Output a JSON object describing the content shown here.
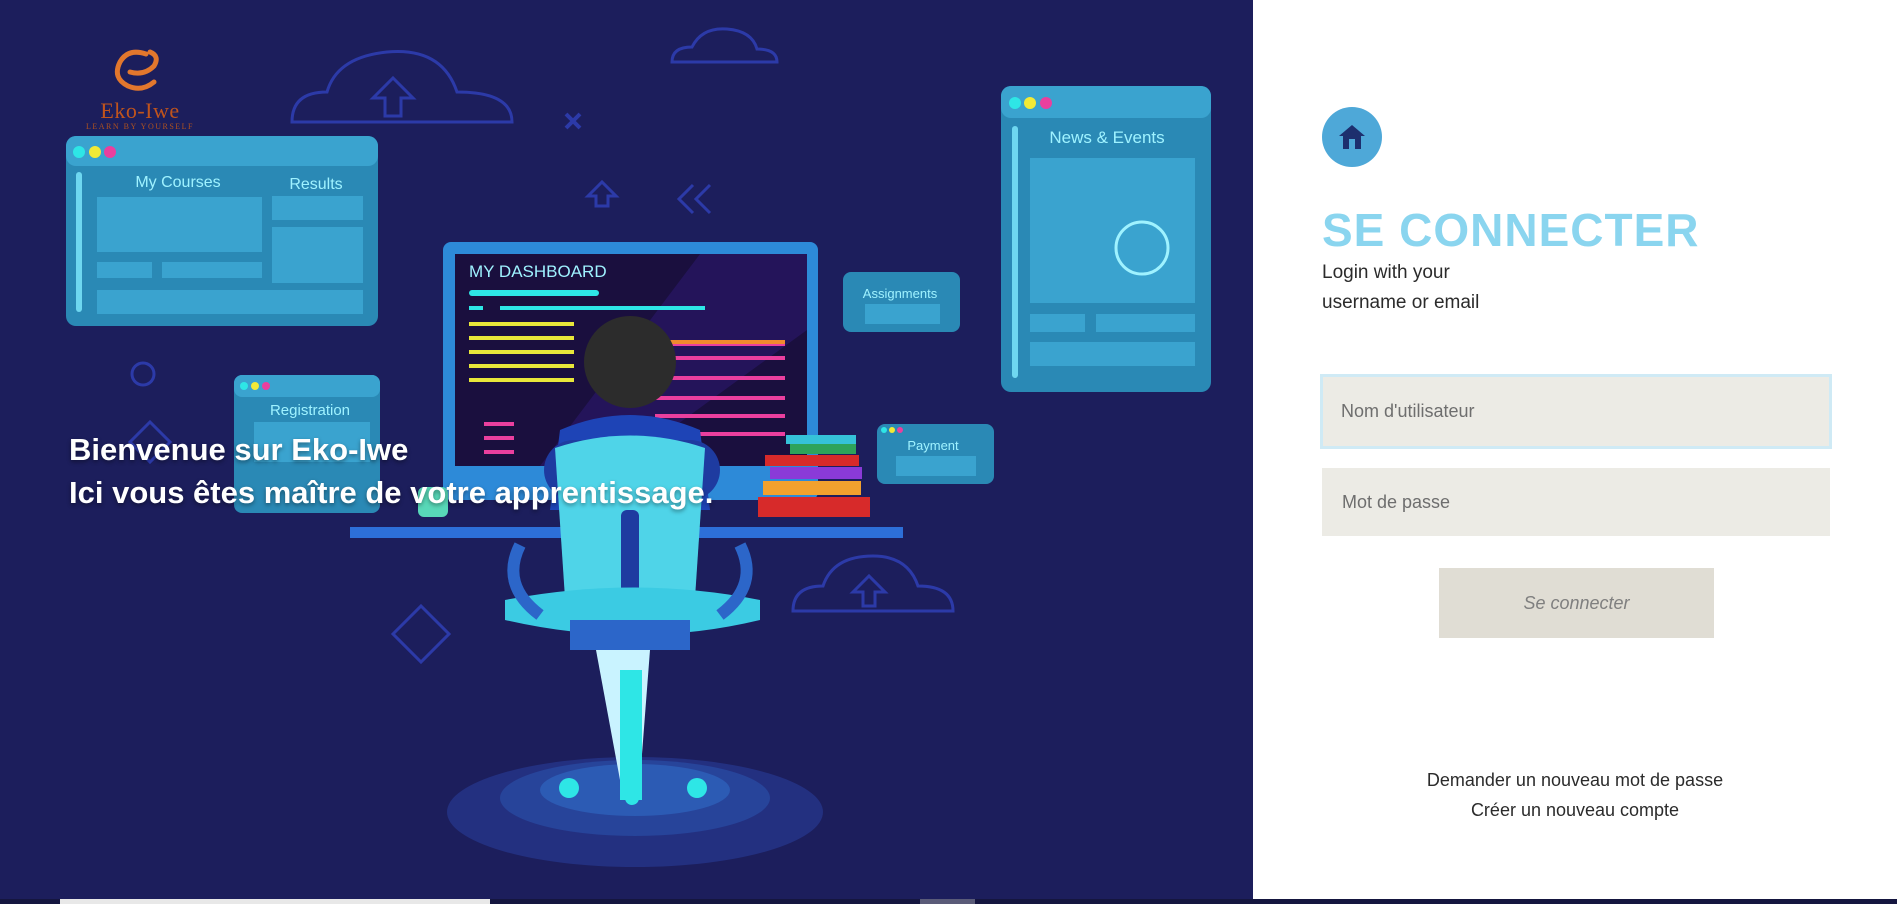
{
  "logo": {
    "brand": "Eko-Iwe",
    "tagline": "LEARN BY YOURSELF"
  },
  "illustration": {
    "courses_title": "My Courses",
    "results_title": "Results",
    "dashboard_title": "MY DASHBOARD",
    "news_title": "News & Events",
    "assignments_title": "Assignments",
    "registration_title": "Registration",
    "payment_title": "Payment"
  },
  "welcome": {
    "line1": "Bienvenue sur Eko-Iwe",
    "line2": "Ici vous êtes maître de votre apprentissage."
  },
  "login": {
    "title": "SE CONNECTER",
    "subtitle_line1": "Login with your",
    "subtitle_line2": "username or email",
    "username_placeholder": "Nom d'utilisateur",
    "password_placeholder": "Mot de passe",
    "submit_label": "Se connecter",
    "reset_link": "Demander un nouveau mot de passe",
    "create_link": "Créer un nouveau compte"
  },
  "colors": {
    "background_left": "#1c1e5c",
    "accent_title": "#8ad5ef",
    "home_button": "#4ea8d8",
    "input_bg": "#ecebe5",
    "button_bg": "#e0ddd4"
  },
  "icons": {
    "home": "home-icon",
    "logo": "eko-iwe-logo-icon"
  }
}
